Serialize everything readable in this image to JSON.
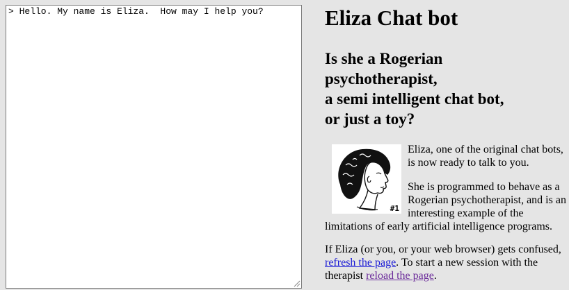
{
  "chat": {
    "transcript": "> Hello. My name is Eliza.  How may I help you?"
  },
  "header": {
    "title": "Eliza Chat bot"
  },
  "subtitle": {
    "line1": "Is she a Rogerian",
    "line2": "psychotherapist,",
    "line3": "a semi intelligent chat bot,",
    "line4": "or just a toy?"
  },
  "portrait": {
    "icon": "woman-profile-sketch-icon",
    "tag": "#1"
  },
  "intro": {
    "para1": "Eliza, one of the original chat bots, is now ready to talk to you.",
    "para2": "She is programmed to behave as a Rogerian psychotherapist, and is an interesting example of the limitations of early artificial intelligence programs."
  },
  "help": {
    "before": "If Eliza (or you, or your web browser) gets confused, ",
    "refresh_link": "refresh the page",
    "middle": ". To start a new session with the therapist ",
    "reload_link": "reload the page",
    "after": "."
  },
  "colors": {
    "background": "#e5e5e5",
    "link": "#1a1ad6",
    "visited_link": "#6b2b9a"
  }
}
